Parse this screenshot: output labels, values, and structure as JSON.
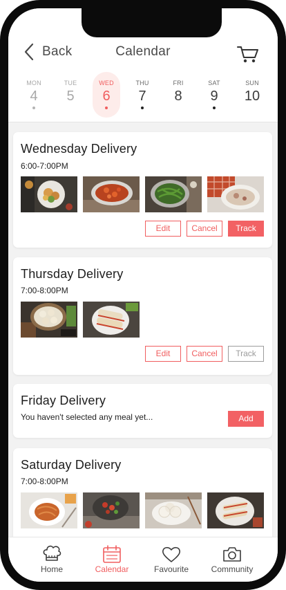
{
  "header": {
    "back_label": "Back",
    "title": "Calendar"
  },
  "week": [
    {
      "name": "MON",
      "num": "4",
      "dot": true,
      "state": "past"
    },
    {
      "name": "TUE",
      "num": "5",
      "dot": false,
      "state": "past"
    },
    {
      "name": "WED",
      "num": "6",
      "dot": true,
      "state": "selected"
    },
    {
      "name": "THU",
      "num": "7",
      "dot": true,
      "state": "future"
    },
    {
      "name": "FRI",
      "num": "8",
      "dot": false,
      "state": "future"
    },
    {
      "name": "SAT",
      "num": "9",
      "dot": true,
      "state": "future"
    },
    {
      "name": "SUN",
      "num": "10",
      "dot": false,
      "state": "future"
    }
  ],
  "deliveries": [
    {
      "title": "Wednesday Delivery",
      "time": "6:00-7:00PM",
      "actions": {
        "edit": "Edit",
        "cancel": "Cancel",
        "track": "Track"
      }
    },
    {
      "title": "Thursday Delivery",
      "time": "7:00-8:00PM",
      "actions": {
        "edit": "Edit",
        "cancel": "Cancel",
        "track": "Track"
      }
    },
    {
      "title": "Friday Delivery",
      "note": "You haven't selected any meal yet...",
      "actions": {
        "add": "Add"
      }
    },
    {
      "title": "Saturday Delivery",
      "time": "7:00-8:00PM"
    }
  ],
  "tabbar": [
    {
      "label": "Home",
      "icon": "chef-hat-icon"
    },
    {
      "label": "Calendar",
      "icon": "calendar-icon",
      "active": true
    },
    {
      "label": "Favourite",
      "icon": "heart-icon"
    },
    {
      "label": "Community",
      "icon": "camera-icon"
    }
  ],
  "colors": {
    "accent": "#f05d5e",
    "accent_light": "#fdecea",
    "background": "#f2f2f2"
  }
}
